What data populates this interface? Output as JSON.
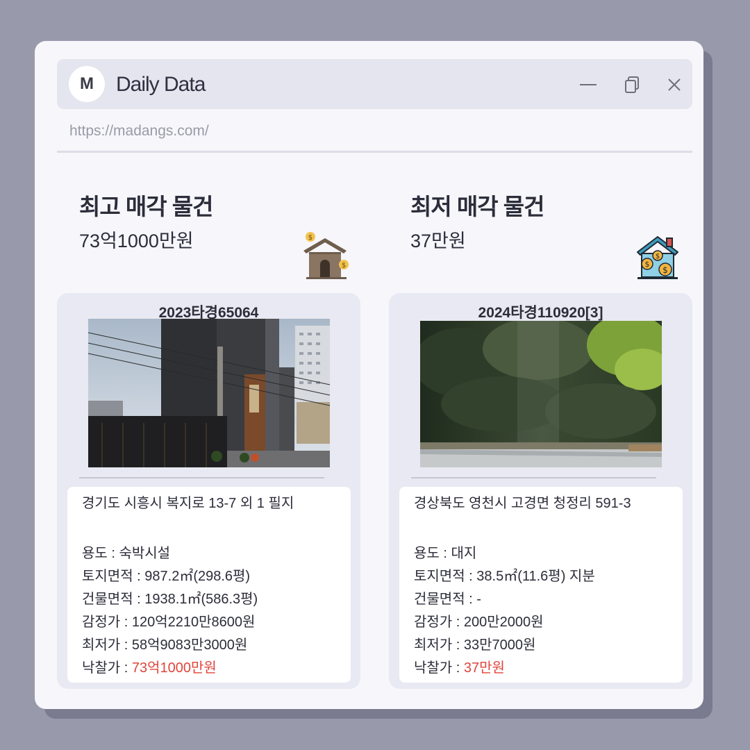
{
  "app": {
    "logo_letter": "M",
    "title": "Daily Data",
    "url": "https://madangs.com/"
  },
  "window_controls": [
    "minimize-icon",
    "restore-icon",
    "close-icon"
  ],
  "colors": {
    "background": "#9899ab",
    "window": "#f6f6fb",
    "card": "#e8e9f2",
    "highlight": "#e0443c"
  },
  "highest": {
    "heading": "최고 매각 물건",
    "price": "73억1000만원",
    "icon": "house-money-icon",
    "case_no": "2023타경65064",
    "photo": "building-photo",
    "address": "경기도 시흥시 복지로 13-7 외 1 필지",
    "usage": "용도 : 숙박시설",
    "land_area": "토지면적 : 987.2㎡(298.6평)",
    "building_area": "건물면적 : 1938.1㎡(586.3평)",
    "appraisal": "감정가 : 120억2210만8600원",
    "minimum": "최저가 : 58억9083만3000원",
    "winning_label": "낙찰가 : ",
    "winning_value": "73억1000만원"
  },
  "lowest": {
    "heading": "최저 매각 물건",
    "price": "37만원",
    "icon": "house-coins-icon",
    "case_no": "2024타경110920[3]",
    "photo": "forest-land-photo",
    "address": "경상북도 영천시 고경면 청정리 591-3",
    "usage": "용도 : 대지",
    "land_area": "토지면적 : 38.5㎡(11.6평) 지분",
    "building_area": "건물면적 : -",
    "appraisal": "감정가 : 200만2000원",
    "minimum": "최저가 : 33만7000원",
    "winning_label": "낙찰가 : ",
    "winning_value": "37만원"
  }
}
